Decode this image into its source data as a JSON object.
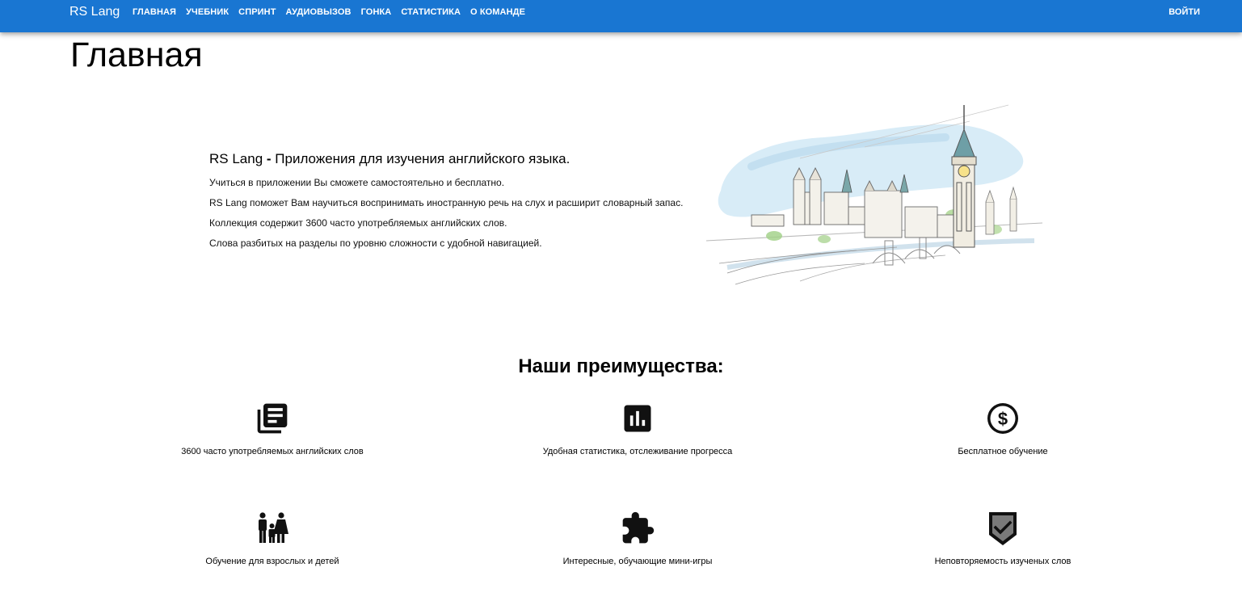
{
  "header": {
    "brand": "RS Lang",
    "nav": [
      "ГЛАВНАЯ",
      "УЧЕБНИК",
      "СПРИНТ",
      "АУДИОВЫЗОВ",
      "ГОНКА",
      "СТАТИСТИКА",
      "О КОМАНДЕ"
    ],
    "login_label": "ВОЙТИ"
  },
  "page": {
    "title": "Главная"
  },
  "intro": {
    "brand": "RS Lang",
    "dash": " - ",
    "heading": "Приложения для изучения английского языка.",
    "lines": [
      "Учиться в приложении Вы сможете самостоятельно и бесплатно.",
      "RS Lang поможет Вам научиться воспринимать иностранную речь на слух и расширит словарный запас.",
      "Коллекция содержит 3600 часто употребляемых английских слов.",
      "Слова разбитых на разделы по уровню сложности с удобной навигацией."
    ]
  },
  "advantages": {
    "title": "Наши преимущества:",
    "items": [
      {
        "icon": "library-books-icon",
        "label": "3600 часто употребляемых английских слов"
      },
      {
        "icon": "bar-chart-icon",
        "label": "Удобная статистика, отслеживание прогресса"
      },
      {
        "icon": "dollar-circle-icon",
        "label": "Бесплатное обучение"
      },
      {
        "icon": "family-icon",
        "label": "Обучение для взрослых и детей"
      },
      {
        "icon": "puzzle-icon",
        "label": "Интересные, обучающие мини-игры"
      },
      {
        "icon": "shield-check-icon",
        "label": "Неповторяемость изученых слов"
      }
    ]
  },
  "colors": {
    "appbar": "#1976d2",
    "text": "#000000",
    "sky_wash": "#cfe6f4"
  }
}
